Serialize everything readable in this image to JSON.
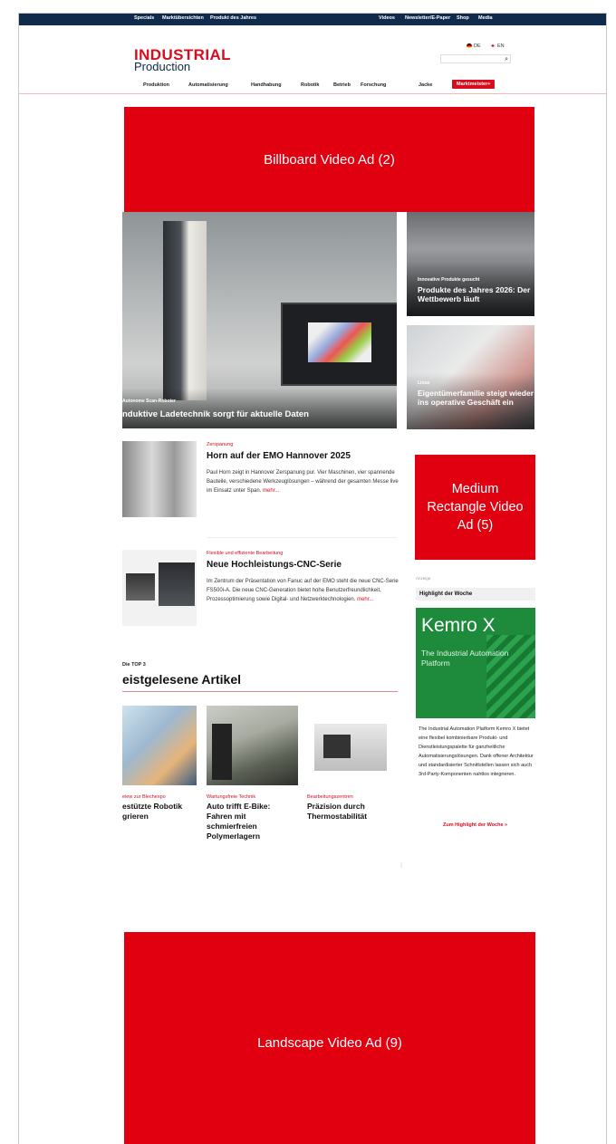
{
  "topbar": {
    "links_left": [
      "Specials",
      "Marktübersichten",
      "Produkt des Jahres"
    ],
    "links_right": [
      "Videos",
      "Newsletter/E-Paper",
      "Shop",
      "Media"
    ]
  },
  "logo": {
    "line1": "INDUSTRIAL",
    "line2": "Production"
  },
  "lang": {
    "de": "DE",
    "en": "EN"
  },
  "nav": [
    "Produktion",
    "Automatisierung",
    "Handhabung",
    "Robotik",
    "Betrieb",
    "Forschung",
    "Jacke",
    "Marktmeister+"
  ],
  "ads": {
    "billboard": "Billboard Video Ad (2)",
    "medium_rectangle": "Medium Rectangle Video Ad (5)",
    "landscape": "Landscape Video Ad (9)"
  },
  "hero": {
    "main": {
      "kicker": "Autonome Scan-Roboter",
      "title": "nduktive Ladetechnik sorgt für aktuelle Daten"
    },
    "side1": {
      "kicker": "Innovative Produkte gesucht",
      "title": "Produkte des Jahres 2026: Der Wettbewerb läuft"
    },
    "side2": {
      "kicker": "Linus",
      "title": "Eigentümerfamilie steigt wieder ins operative Geschäft ein"
    }
  },
  "articles": [
    {
      "kicker": "Zerspanung",
      "title": "Horn auf der EMO Hannover 2025",
      "text": "Paul Horn zeigt in Hannover Zerspanung pur. Vier Maschinen, vier spannende Bauteile, verschiedene Werkzeuglösungen – während der gesamten Messe live im Einsatz unter Span.",
      "more": "mehr..."
    },
    {
      "kicker": "Flexible und effiziente Bearbeitung",
      "title": "Neue Hochleistungs-CNC-Serie",
      "text": "Im Zentrum der Präsentation von Fanuc auf der EMO steht die neue CNC-Serie FS500i-A. Die neue CNC-Generation bietet hohe Benutzerfreundlichkeit, Prozessoptimierung sowie Digital- und Netzwerktechnologien.",
      "more": "mehr..."
    }
  ],
  "top3": {
    "label": "Die TOP 3",
    "title": "eistgelesene Artikel",
    "items": [
      {
        "kicker": "eiew zur Blechexpo",
        "title": "estützte Robotik\ngrieren"
      },
      {
        "kicker": "Wartungsfreie Technik",
        "title": "Auto trifft E-Bike: Fahren mit schmierfreien Polymerlagern"
      },
      {
        "kicker": "Bearbeitungszentren",
        "title": "Präzision durch Thermostabilität"
      }
    ]
  },
  "sidebar": {
    "label": "Anzeige",
    "head": "Highlight der Woche",
    "ad_title": "Kemro X",
    "ad_sub": "The Industrial Automation Platform",
    "text": "The Industrial Automation Platform Kemro X bietet eine flexibel kombinierbare Produkt- und Dienstleistungspalette für ganzheitliche Automatisierungslösungen. Dank offener Architektur und standardisierter Schnittstellen lassen sich auch 3rd-Party-Komponenten nahtlos integrieren.",
    "link": "Zum Highlight der Woche »"
  },
  "colors": {
    "brand_red": "#d80c1c",
    "ad_red": "#e1000f",
    "navy": "#0f2a4a",
    "kemro_green": "#1e8a3c"
  }
}
